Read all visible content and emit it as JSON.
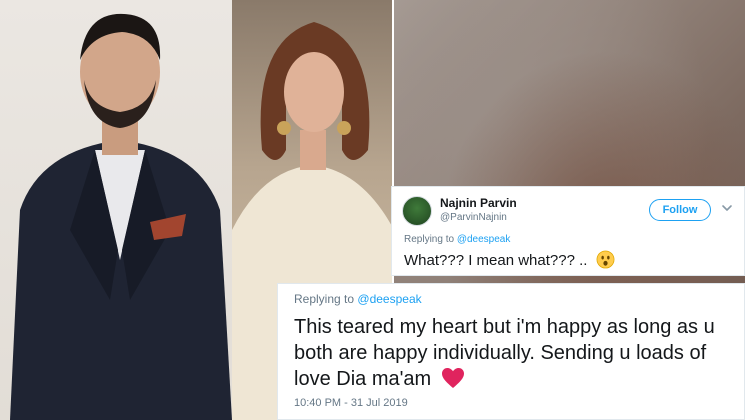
{
  "tweet": {
    "display_name": "Najnin Parvin",
    "handle": "@ParvinNajnin",
    "follow_label": "Follow",
    "replying_prefix": "Replying to",
    "replying_mention": "@deespeak",
    "text": "What??? I mean what??? ..",
    "emoji": "surprised-face-emoji"
  },
  "reply": {
    "replying_prefix": "Replying to",
    "replying_mention": "@deespeak",
    "text": "This teared my heart but i'm happy as long as u both are happy individually. Sending u loads of love Dia ma'am",
    "emoji": "heart-icon",
    "timestamp": "10:40 PM - 31 Jul 2019"
  },
  "colors": {
    "twitter_blue": "#1da1f2",
    "heart_red": "#e0245e",
    "secondary_text": "#657786",
    "primary_text": "#14171a"
  }
}
